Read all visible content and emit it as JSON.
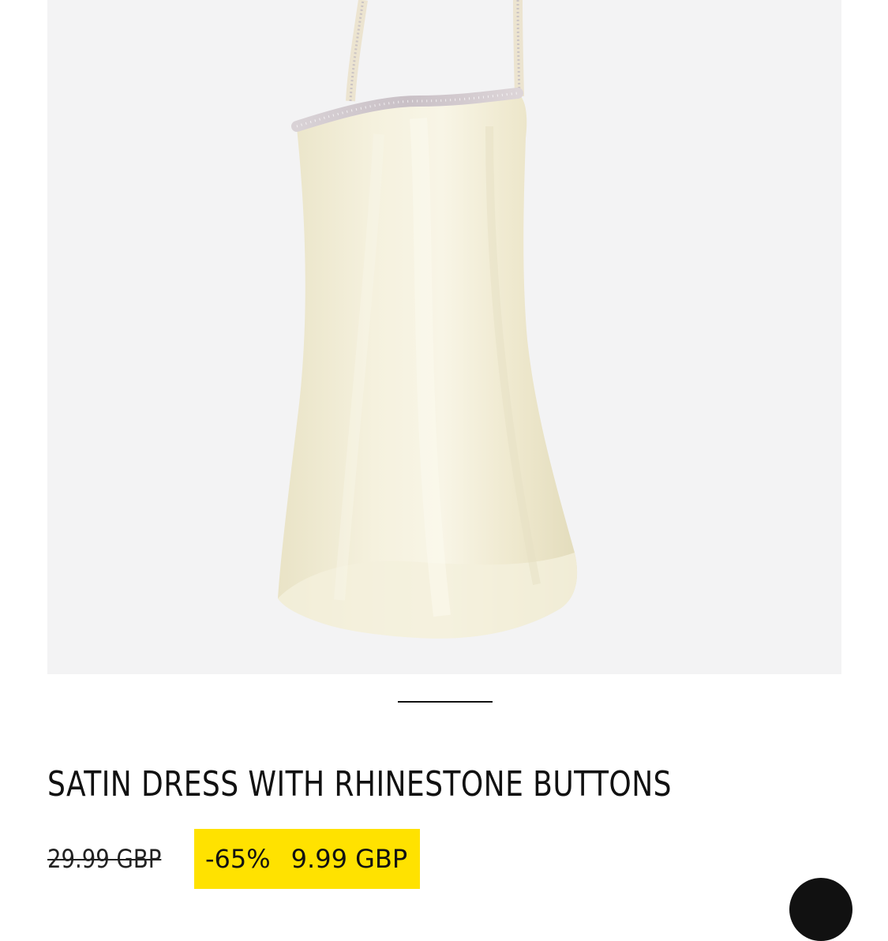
{
  "product": {
    "image_icon": "satin-slip-dress-image",
    "title": "SATIN DRESS WITH RHINESTONE BUTTONS",
    "old_price": "29.99 GBP",
    "discount": "-65%",
    "new_price": "9.99 GBP"
  },
  "carousel": {
    "active_index": 1
  },
  "colors": {
    "image_background": "#f3f3f4",
    "sale_badge": "#ffe200",
    "text": "#111111"
  },
  "icons": {
    "floating_button": "circle-button"
  }
}
